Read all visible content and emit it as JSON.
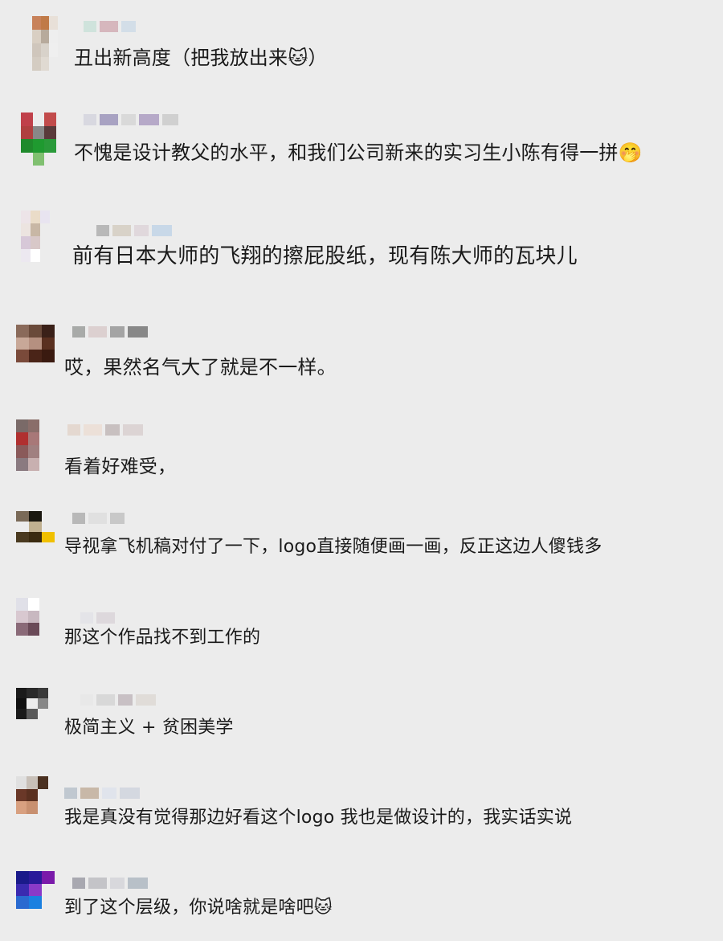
{
  "comments": [
    {
      "text": "丑出新高度（把我放出来🐱）",
      "avatar_colors": [
        "#c8825a",
        "#c07a48",
        "#e8e0d8",
        "#d9cfc3",
        "#b7aa9c",
        "#eee",
        "#cfc6bc",
        "#d8d2ca",
        "#efefef",
        "#d4ccc2",
        "#e0dad2",
        "#ececec"
      ],
      "name_colors": [
        "#cfe3dc",
        "#d6b7bd",
        "#d3dee8"
      ]
    },
    {
      "text": "不愧是设计教父的水平，和我们公司新来的实习生小陈有得一拼🤭",
      "avatar_colors": [
        "#c0404a",
        "#ececec",
        "#c24b4b",
        "#b04040",
        "#888",
        "#5a3a3a",
        "#1f8a2c",
        "#1f9a30",
        "#2a9a3a",
        "#ececec",
        "#80c070",
        "#ececec"
      ],
      "name_colors": [
        "#d8d8e0",
        "#a8a2c2",
        "#d9d9d9",
        "#b6a9c8",
        "#d0d0d0"
      ]
    },
    {
      "text": "前有日本大师的飞翔的擦屁股纸，现有陈大师的瓦块儿",
      "avatar_colors": [
        "#ede4e8",
        "#eadcc8",
        "#e8e4f0",
        "#ece4e0",
        "#c8b7a5",
        "#ececec",
        "#d7c8d8",
        "#d8c8c8",
        "#ececec",
        "#ece8f0",
        "#ffffff",
        "#ececec"
      ],
      "name_colors": [
        "#b8b8b8",
        "#d8d2c8",
        "#e0d8dc",
        "#c8d8e8"
      ]
    },
    {
      "text": "哎，果然名气大了就是不一样。",
      "avatar_colors": [
        "#8a6a5a",
        "#6a4a3a",
        "#3a2018",
        "#c8a898",
        "#b59080",
        "#5a3020",
        "#7a4a3a",
        "#4a2418",
        "#3a1a10",
        "#ececec",
        "#ececec",
        "#ececec"
      ],
      "name_colors": [
        "#a8aaa8",
        "#dcd0d0",
        "#a4a4a4",
        "#888"
      ]
    },
    {
      "text": "看着好难受，",
      "avatar_colors": [
        "#7a6a68",
        "#8a6e6a",
        "#ececec",
        "#b03030",
        "#a87878",
        "#ececec",
        "#8a5a5a",
        "#a08080",
        "#ececec",
        "#8a7a80",
        "#c8b0b0",
        "#ececec"
      ],
      "name_colors": [
        "#e4d8d0",
        "#ece0d8",
        "#c8c0c0",
        "#dcd4d4"
      ]
    },
    {
      "text": "导视拿飞机稿对付了一下，logo直接随便画一画，反正这边人傻钱多",
      "avatar_colors": [
        "#7a6a58",
        "#1a1810",
        "#ececec",
        "#ececec",
        "#c0b090",
        "#ececec",
        "#4a3a20",
        "#3a2a10",
        "#f0c000",
        "#ececec",
        "#ececec",
        "#ececec"
      ],
      "name_colors": [
        "#b8b8b8",
        "#e0e0e0",
        "#c8c8c8"
      ]
    },
    {
      "text": "那这个作品找不到工作的",
      "avatar_colors": [
        "#e0e0e8",
        "#ffffff",
        "#ececec",
        "#d8c8d0",
        "#c8b8c0",
        "#ececec",
        "#8a6a78",
        "#6a4a58",
        "#ececec",
        "#ececec",
        "#ececec",
        "#ececec"
      ],
      "name_colors": [
        "#e4e4e8",
        "#ddd8dc"
      ]
    },
    {
      "text": "极简主义 + 贫困美学",
      "avatar_colors": [
        "#1a1a1a",
        "#2a2a2a",
        "#3a3a3a",
        "#101010",
        "#ececec",
        "#888",
        "#1a1a1a",
        "#5a5a5a",
        "#ececec",
        "#ececec",
        "#ececec",
        "#ececec"
      ],
      "name_colors": [
        "#e8e8e8",
        "#d8d8d8",
        "#c8c0c4",
        "#e0dcd8"
      ]
    },
    {
      "text": "我是真没有觉得那边好看这个logo  我也是做设计的，我实话实说",
      "avatar_colors": [
        "#e0e0e0",
        "#c8c0b8",
        "#4a3020",
        "#6a3828",
        "#5a3020",
        "#ececec",
        "#d8a080",
        "#c89070",
        "#ececec",
        "#ececec",
        "#ececec",
        "#ececec"
      ],
      "name_colors": [
        "#c0c8d0",
        "#c8b8a8",
        "#e0e4ec",
        "#d4d8e0"
      ]
    },
    {
      "text": "到了这个层级，你说啥就是啥吧🐱",
      "avatar_colors": [
        "#1a1a8a",
        "#2a1a9a",
        "#7a1aaa",
        "#3a2ab0",
        "#8a3ac8",
        "#ececec",
        "#2a6ad0",
        "#1a80e0",
        "#ececec",
        "#ececec",
        "#ececec",
        "#ececec"
      ],
      "name_colors": [
        "#a8a8b0",
        "#c4c4c8",
        "#d8d8dc",
        "#b8c0c8"
      ]
    }
  ]
}
